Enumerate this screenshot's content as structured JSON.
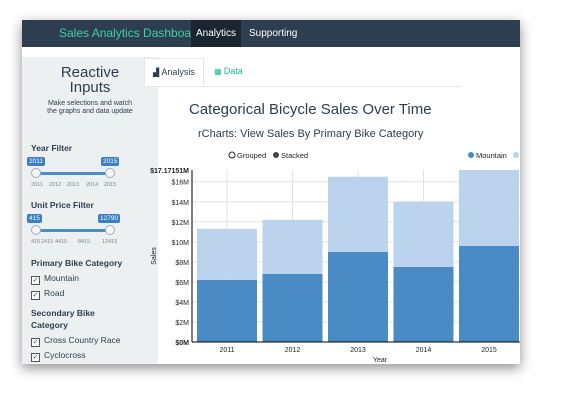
{
  "navbar": {
    "brand": "Sales Analytics Dashboard",
    "tabs": [
      {
        "label": "Analytics",
        "active": true
      },
      {
        "label": "Supporting Docs",
        "active": false
      }
    ]
  },
  "sidebar": {
    "title_line1": "Reactive",
    "title_line2": "Inputs",
    "description_line1": "Make selections and watch",
    "description_line2": "the graphs and data update",
    "year_filter": {
      "label": "Year Filter",
      "min_value": "2011",
      "max_value": "2015",
      "ticks": [
        "2011",
        "2012",
        "2013",
        "2014",
        "2015"
      ]
    },
    "price_filter": {
      "label": "Unit Price Filter",
      "min_value": "415",
      "max_value": "12790",
      "ticks": [
        "415",
        "2415",
        "4415",
        "8415",
        "12415"
      ]
    },
    "primary_category": {
      "label": "Primary Bike Category",
      "options": [
        {
          "label": "Mountain",
          "checked": true
        },
        {
          "label": "Road",
          "checked": true
        }
      ]
    },
    "secondary_category": {
      "label_line1": "Secondary Bike",
      "label_line2": "Category",
      "options": [
        {
          "label": "Cross Country Race",
          "checked": true
        },
        {
          "label": "Cyclocross",
          "checked": true
        }
      ]
    }
  },
  "main_tabs": [
    {
      "label": "Analysis",
      "icon": "bar-chart-icon",
      "active": true
    },
    {
      "label": "Data",
      "icon": "table-icon",
      "active": false
    }
  ],
  "page_title": "Categorical Bicycle Sales Over Time",
  "controls": {
    "grouped_label": "Grouped",
    "stacked_label": "Stacked",
    "selected": "Stacked"
  },
  "chart_data": {
    "type": "bar",
    "stacked": true,
    "title": "rCharts: View Sales By Primary Bike Category",
    "xlabel": "Year",
    "ylabel": "Sales",
    "categories": [
      "2011",
      "2012",
      "2013",
      "2014",
      "2015"
    ],
    "series": [
      {
        "name": "Mountain",
        "color": "#4a8bc5",
        "values": [
          6.2,
          6.8,
          9.0,
          7.5,
          9.6
        ]
      },
      {
        "name": "Road",
        "color": "#bcd3ee",
        "values": [
          5.1,
          5.4,
          7.5,
          6.5,
          7.57
        ]
      }
    ],
    "ylim": [
      0,
      17.17151
    ],
    "yticks": [
      "$0M",
      "$2M",
      "$4M",
      "$6M",
      "$8M",
      "$10M",
      "$12M",
      "$14M",
      "$16M"
    ],
    "ymax_label": "$17.17151M",
    "legend_position": "top-right",
    "grid": true
  }
}
